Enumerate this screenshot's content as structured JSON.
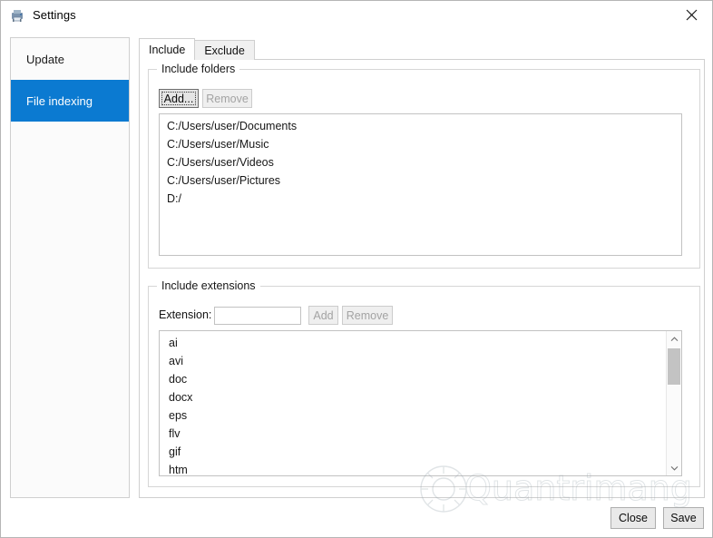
{
  "window": {
    "title": "Settings",
    "app_icon": "printer-icon",
    "close_label": "✕"
  },
  "sidebar": {
    "items": [
      {
        "label": "Update",
        "selected": false
      },
      {
        "label": "File indexing",
        "selected": true
      }
    ]
  },
  "tabs": [
    {
      "label": "Include",
      "active": true
    },
    {
      "label": "Exclude",
      "active": false
    }
  ],
  "include_folders": {
    "group_title": "Include folders",
    "add_button": "Add...",
    "remove_button": "Remove",
    "items": [
      "C:/Users/user/Documents",
      "C:/Users/user/Music",
      "C:/Users/user/Videos",
      "C:/Users/user/Pictures",
      "D:/"
    ]
  },
  "include_extensions": {
    "group_title": "Include extensions",
    "extension_label": "Extension:",
    "extension_value": "",
    "extension_placeholder": "",
    "add_button": "Add",
    "remove_button": "Remove",
    "items": [
      "ai",
      "avi",
      "doc",
      "docx",
      "eps",
      "flv",
      "gif",
      "htm"
    ]
  },
  "footer": {
    "close_button": "Close",
    "save_button": "Save"
  },
  "watermark": {
    "text": "Quantrimang",
    "logo": "sun-gear-logo"
  },
  "colors": {
    "accent": "#0b7ad1",
    "window_bg": "#ffffff",
    "border": "#cfcfcf",
    "button_bg": "#e9e9e9",
    "disabled_text": "#a3a3a3"
  }
}
